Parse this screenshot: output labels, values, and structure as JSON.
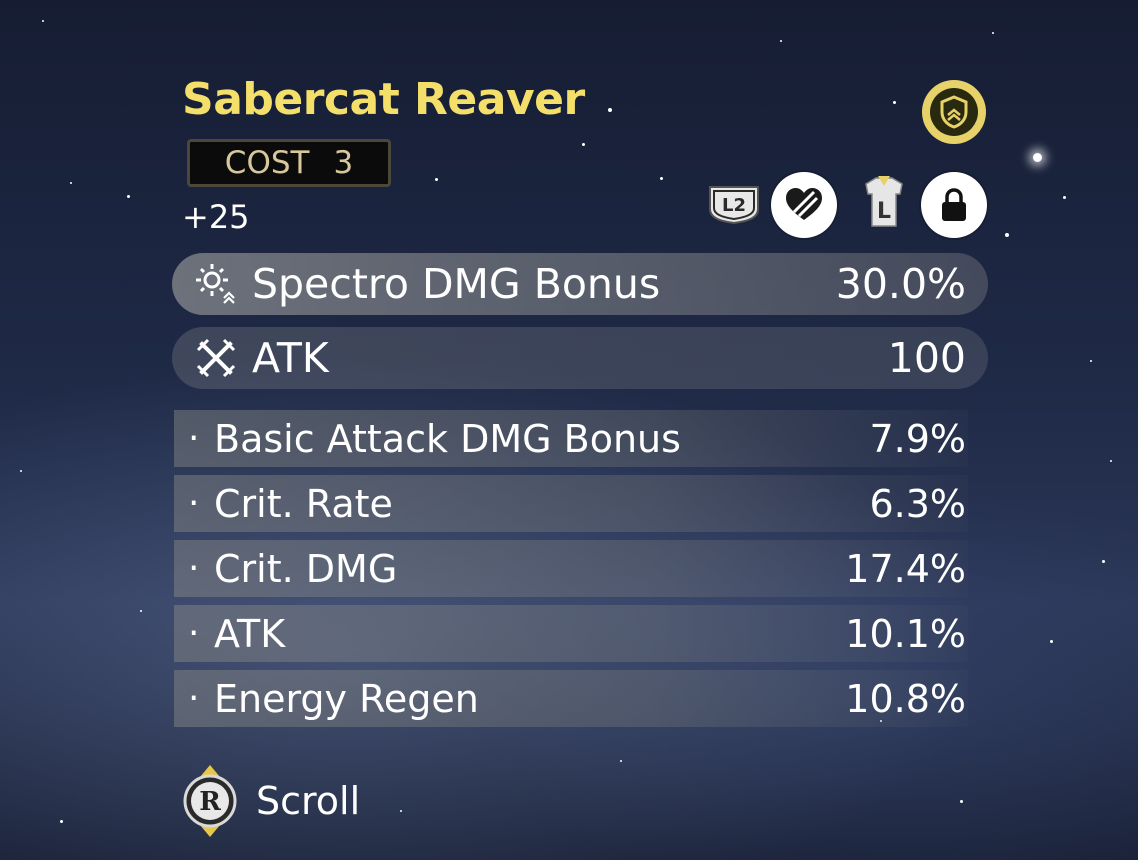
{
  "echo": {
    "name": "Sabercat Reaver",
    "cost_label": "COST",
    "cost_value": "3",
    "level": "+25"
  },
  "badges": {
    "tune_level": "L2",
    "equip_mark": "L"
  },
  "main_stats": [
    {
      "icon": "spectro-icon",
      "label": "Spectro DMG Bonus",
      "value": "30.0%"
    },
    {
      "icon": "atk-sword-icon",
      "label": "ATK",
      "value": "100"
    }
  ],
  "sub_stats": [
    {
      "bullet": "·",
      "label": "Basic Attack DMG Bonus",
      "value": "7.9%"
    },
    {
      "bullet": "·",
      "label": "Crit. Rate",
      "value": "6.3%"
    },
    {
      "bullet": "·",
      "label": "Crit. DMG",
      "value": "17.4%"
    },
    {
      "bullet": "·",
      "label": "ATK",
      "value": "10.1%"
    },
    {
      "bullet": "·",
      "label": "Energy Regen",
      "value": "10.8%"
    }
  ],
  "controls": {
    "scroll_key": "R",
    "scroll_label": "Scroll"
  },
  "colors": {
    "title": "#f3df6a",
    "shield_badge": "#e7d26a",
    "cost_text": "#d8c79a",
    "cost_bg": "#0b0b0b"
  }
}
